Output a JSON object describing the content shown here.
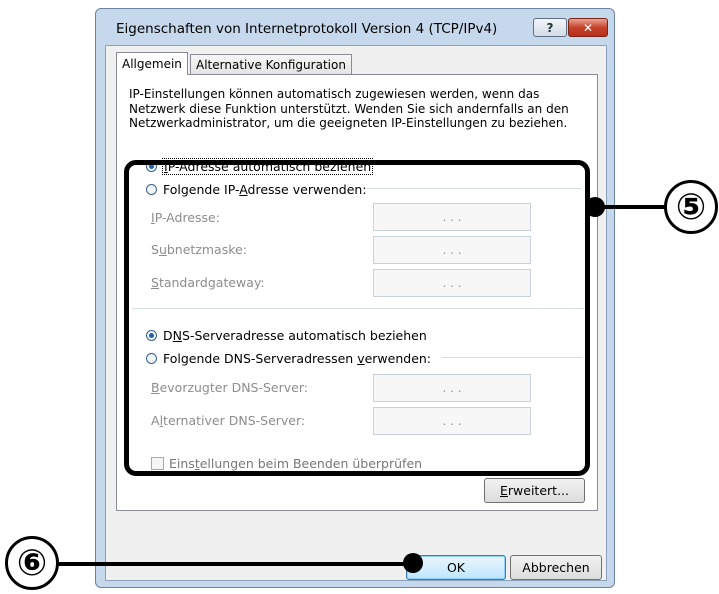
{
  "window": {
    "title": "Eigenschaften von Internetprotokoll Version 4 (TCP/IPv4)",
    "help_label": "?",
    "close_label": "✕"
  },
  "tabs": [
    {
      "label": "Allgemein",
      "selected": true
    },
    {
      "label": "Alternative Konfiguration",
      "selected": false
    }
  ],
  "intro_text": "IP-Einstellungen können automatisch zugewiesen werden, wenn das Netzwerk diese Funktion unterstützt. Wenden Sie sich andernfalls an den Netzwerkadministrator, um die geeigneten IP-Einstellungen zu beziehen.",
  "ip_group": {
    "auto_option": {
      "pre": "",
      "accel": "I",
      "post": "P-Adresse automatisch beziehen",
      "selected": true
    },
    "manual_option": {
      "pre": "Folgende IP-",
      "accel": "A",
      "post": "dresse verwenden:",
      "selected": false
    },
    "fields": [
      {
        "pre": "",
        "accel": "I",
        "post": "P-Adresse:",
        "value": ".   .   ."
      },
      {
        "pre": "S",
        "accel": "u",
        "post": "bnetzmaske:",
        "value": ".   .   ."
      },
      {
        "pre": "",
        "accel": "S",
        "post": "tandardgateway:",
        "value": ".   .   ."
      }
    ]
  },
  "dns_group": {
    "auto_option": {
      "pre": "D",
      "accel": "N",
      "post": "S-Serveradresse automatisch beziehen",
      "selected": true
    },
    "manual_option": {
      "pre": "Folgende DNS-Serveradressen ",
      "accel": "v",
      "post": "erwenden:",
      "selected": false
    },
    "fields": [
      {
        "pre": "",
        "accel": "B",
        "post": "evorzugter DNS-Server:",
        "value": ".   .   ."
      },
      {
        "pre": "A",
        "accel": "l",
        "post": "ternativer DNS-Server:",
        "value": ".   .   ."
      }
    ]
  },
  "validate_checkbox": {
    "pre": "Eins",
    "accel": "t",
    "post": "ellungen beim Beenden überprüfen",
    "checked": false
  },
  "advanced_button": {
    "pre": "",
    "accel": "E",
    "post": "rweitert..."
  },
  "ok_button": "OK",
  "cancel_button": "Abbrechen",
  "callouts": [
    {
      "label": "⑤"
    },
    {
      "label": "⑥"
    }
  ]
}
